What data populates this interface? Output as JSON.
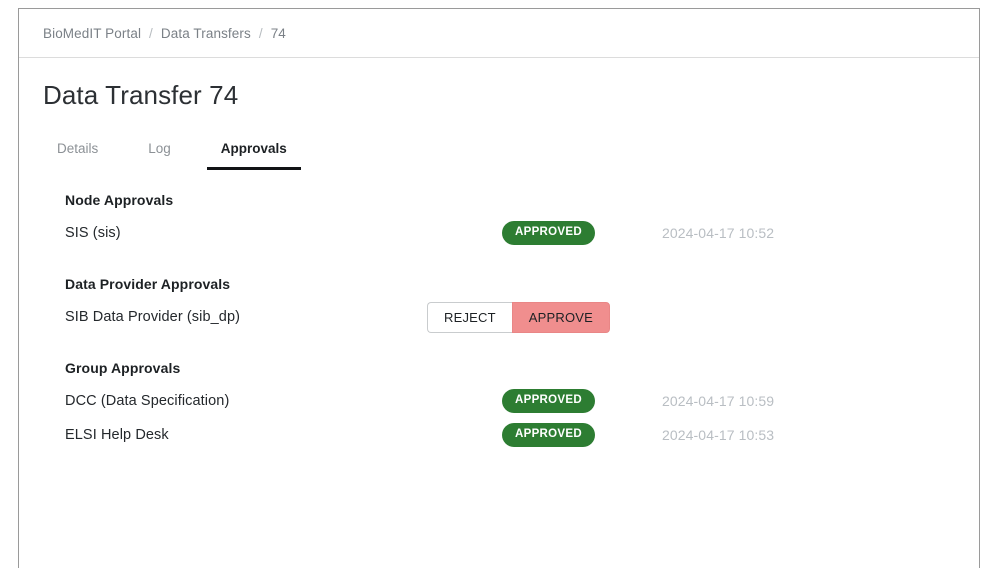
{
  "breadcrumb": {
    "items": [
      "BioMedIT Portal",
      "Data Transfers",
      "74"
    ],
    "separator": "/"
  },
  "page": {
    "title": "Data Transfer 74"
  },
  "tabs": [
    {
      "label": "Details",
      "active": false
    },
    {
      "label": "Log",
      "active": false
    },
    {
      "label": "Approvals",
      "active": true
    }
  ],
  "sections": [
    {
      "title": "Node Approvals",
      "rows": [
        {
          "label": "SIS (sis)",
          "action": "badge",
          "badge": "APPROVED",
          "time": "2024-04-17 10:52"
        }
      ]
    },
    {
      "title": "Data Provider Approvals",
      "rows": [
        {
          "label": "SIB Data Provider (sib_dp)",
          "action": "buttons",
          "reject_label": "REJECT",
          "approve_label": "APPROVE",
          "time": ""
        }
      ]
    },
    {
      "title": "Group Approvals",
      "rows": [
        {
          "label": "DCC (Data Specification)",
          "action": "badge",
          "badge": "APPROVED",
          "time": "2024-04-17 10:59"
        },
        {
          "label": "ELSI Help Desk",
          "action": "badge",
          "badge": "APPROVED",
          "time": "2024-04-17 10:53"
        }
      ]
    }
  ],
  "colors": {
    "approved_green": "#2d7d32",
    "approve_button_pink": "#f08e8e",
    "breadcrumb_gray": "#7b8187",
    "timestamp_gray": "#b9bec3",
    "active_tab_underline": "#111316"
  }
}
